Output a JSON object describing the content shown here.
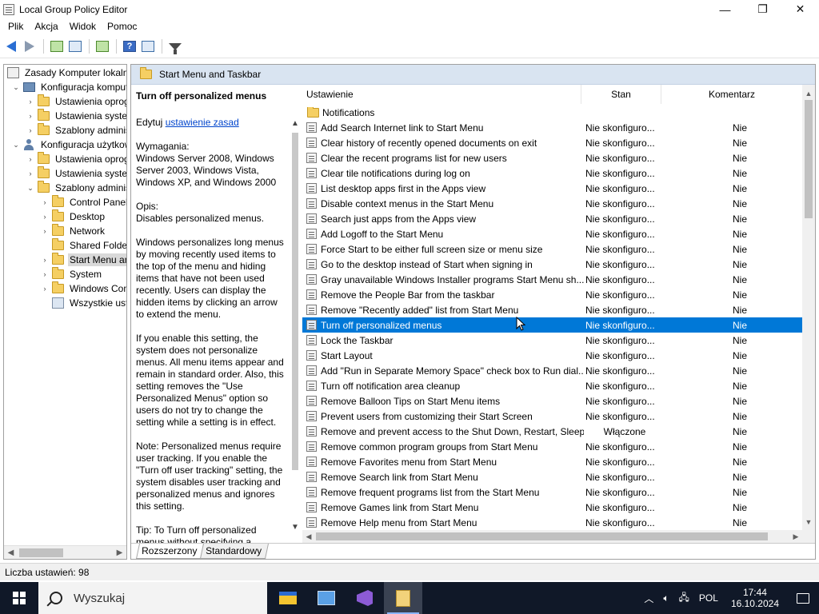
{
  "window": {
    "title": "Local Group Policy Editor",
    "minimize": "—",
    "maximize": "❐",
    "close": "✕"
  },
  "menu": [
    "Plik",
    "Akcja",
    "Widok",
    "Pomoc"
  ],
  "tree": {
    "root": "Zasady Komputer lokalny",
    "items": [
      {
        "label": "Zasady Komputer lokalny",
        "level": 0,
        "twisty": "",
        "icon": "gpo"
      },
      {
        "label": "Konfiguracja komputera",
        "level": 1,
        "twisty": "v",
        "icon": "pc"
      },
      {
        "label": "Ustawienia oprogramowania",
        "level": 2,
        "twisty": ">",
        "icon": "folder"
      },
      {
        "label": "Ustawienia systemu Windows",
        "level": 2,
        "twisty": ">",
        "icon": "folder"
      },
      {
        "label": "Szablony administracyjne",
        "level": 2,
        "twisty": ">",
        "icon": "folder"
      },
      {
        "label": "Konfiguracja użytkownika",
        "level": 1,
        "twisty": "v",
        "icon": "user"
      },
      {
        "label": "Ustawienia oprogramowania",
        "level": 2,
        "twisty": ">",
        "icon": "folder"
      },
      {
        "label": "Ustawienia systemu Windows",
        "level": 2,
        "twisty": ">",
        "icon": "folder"
      },
      {
        "label": "Szablony administracyjne",
        "level": 2,
        "twisty": "v",
        "icon": "folder"
      },
      {
        "label": "Control Panel",
        "level": 3,
        "twisty": ">",
        "icon": "folder"
      },
      {
        "label": "Desktop",
        "level": 3,
        "twisty": ">",
        "icon": "folder"
      },
      {
        "label": "Network",
        "level": 3,
        "twisty": ">",
        "icon": "folder"
      },
      {
        "label": "Shared Folders",
        "level": 3,
        "twisty": "",
        "icon": "folder"
      },
      {
        "label": "Start Menu and Taskbar",
        "level": 3,
        "twisty": ">",
        "icon": "folder",
        "selected": true
      },
      {
        "label": "System",
        "level": 3,
        "twisty": ">",
        "icon": "folder"
      },
      {
        "label": "Windows Components",
        "level": 3,
        "twisty": ">",
        "icon": "folder"
      },
      {
        "label": "Wszystkie ustawienia",
        "level": 3,
        "twisty": "",
        "icon": "cfg"
      }
    ]
  },
  "panel": {
    "header": "Start Menu and Taskbar",
    "desc_title": "Turn off personalized menus",
    "edit_prefix": "Edytuj ",
    "edit_link": "ustawienie zasad",
    "requirements_label": "Wymagania:",
    "requirements": "Windows Server 2008, Windows Server 2003, Windows Vista, Windows XP, and Windows 2000",
    "desc_label": "Opis:",
    "desc_short": "Disables personalized menus.",
    "desc_p1": "Windows personalizes long menus by moving recently used items to the top of the menu and hiding items that have not been used recently. Users can display the hidden items by clicking an arrow to extend the menu.",
    "desc_p2": "If you enable this setting, the system does not personalize menus. All menu items appear and remain in standard order. Also, this setting removes the \"Use Personalized Menus\" option so users do not try to change the setting while a setting is in effect.",
    "desc_p3": "Note: Personalized menus require user tracking. If you enable the \"Turn off user tracking\" setting, the system disables user tracking and personalized menus and ignores this setting.",
    "desc_p4": "Tip: To Turn off personalized menus without specifying a"
  },
  "list": {
    "col_setting": "Ustawienie",
    "col_state": "Stan",
    "col_comment": "Komentarz",
    "folder_row": "Notifications",
    "rows": [
      {
        "name": "Add Search Internet link to Start Menu",
        "state": "Nie skonfiguro...",
        "comment": "Nie"
      },
      {
        "name": "Clear history of recently opened documents on exit",
        "state": "Nie skonfiguro...",
        "comment": "Nie"
      },
      {
        "name": "Clear the recent programs list for new users",
        "state": "Nie skonfiguro...",
        "comment": "Nie"
      },
      {
        "name": "Clear tile notifications during log on",
        "state": "Nie skonfiguro...",
        "comment": "Nie"
      },
      {
        "name": "List desktop apps first in the Apps view",
        "state": "Nie skonfiguro...",
        "comment": "Nie"
      },
      {
        "name": "Disable context menus in the Start Menu",
        "state": "Nie skonfiguro...",
        "comment": "Nie"
      },
      {
        "name": "Search just apps from the Apps view",
        "state": "Nie skonfiguro...",
        "comment": "Nie"
      },
      {
        "name": "Add Logoff to the Start Menu",
        "state": "Nie skonfiguro...",
        "comment": "Nie"
      },
      {
        "name": "Force Start to be either full screen size or menu size",
        "state": "Nie skonfiguro...",
        "comment": "Nie"
      },
      {
        "name": "Go to the desktop instead of Start when signing in",
        "state": "Nie skonfiguro...",
        "comment": "Nie"
      },
      {
        "name": "Gray unavailable Windows Installer programs Start Menu sh...",
        "state": "Nie skonfiguro...",
        "comment": "Nie"
      },
      {
        "name": "Remove the People Bar from the taskbar",
        "state": "Nie skonfiguro...",
        "comment": "Nie"
      },
      {
        "name": "Remove \"Recently added\" list from Start Menu",
        "state": "Nie skonfiguro...",
        "comment": "Nie"
      },
      {
        "name": "Turn off personalized menus",
        "state": "Nie skonfiguro...",
        "comment": "Nie",
        "selected": true
      },
      {
        "name": "Lock the Taskbar",
        "state": "Nie skonfiguro...",
        "comment": "Nie"
      },
      {
        "name": "Start Layout",
        "state": "Nie skonfiguro...",
        "comment": "Nie"
      },
      {
        "name": "Add \"Run in Separate Memory Space\" check box to Run dial...",
        "state": "Nie skonfiguro...",
        "comment": "Nie"
      },
      {
        "name": "Turn off notification area cleanup",
        "state": "Nie skonfiguro...",
        "comment": "Nie"
      },
      {
        "name": "Remove Balloon Tips on Start Menu items",
        "state": "Nie skonfiguro...",
        "comment": "Nie"
      },
      {
        "name": "Prevent users from customizing their Start Screen",
        "state": "Nie skonfiguro...",
        "comment": "Nie"
      },
      {
        "name": "Remove and prevent access to the Shut Down, Restart, Sleep...",
        "state": "Włączone",
        "comment": "Nie"
      },
      {
        "name": "Remove common program groups from Start Menu",
        "state": "Nie skonfiguro...",
        "comment": "Nie"
      },
      {
        "name": "Remove Favorites menu from Start Menu",
        "state": "Nie skonfiguro...",
        "comment": "Nie"
      },
      {
        "name": "Remove Search link from Start Menu",
        "state": "Nie skonfiguro...",
        "comment": "Nie"
      },
      {
        "name": "Remove frequent programs list from the Start Menu",
        "state": "Nie skonfiguro...",
        "comment": "Nie"
      },
      {
        "name": "Remove Games link from Start Menu",
        "state": "Nie skonfiguro...",
        "comment": "Nie"
      },
      {
        "name": "Remove Help menu from Start Menu",
        "state": "Nie skonfiguro...",
        "comment": "Nie"
      }
    ]
  },
  "tabs": [
    "Rozszerzony",
    "Standardowy"
  ],
  "status": "Liczba ustawień: 98",
  "taskbar": {
    "search_placeholder": "Wyszukaj",
    "language": "POL",
    "time": "17:44",
    "date": "16.10.2024"
  },
  "icons": {
    "back": "back-arrow-icon",
    "forward": "forward-arrow-icon",
    "filter": "filter-icon"
  }
}
